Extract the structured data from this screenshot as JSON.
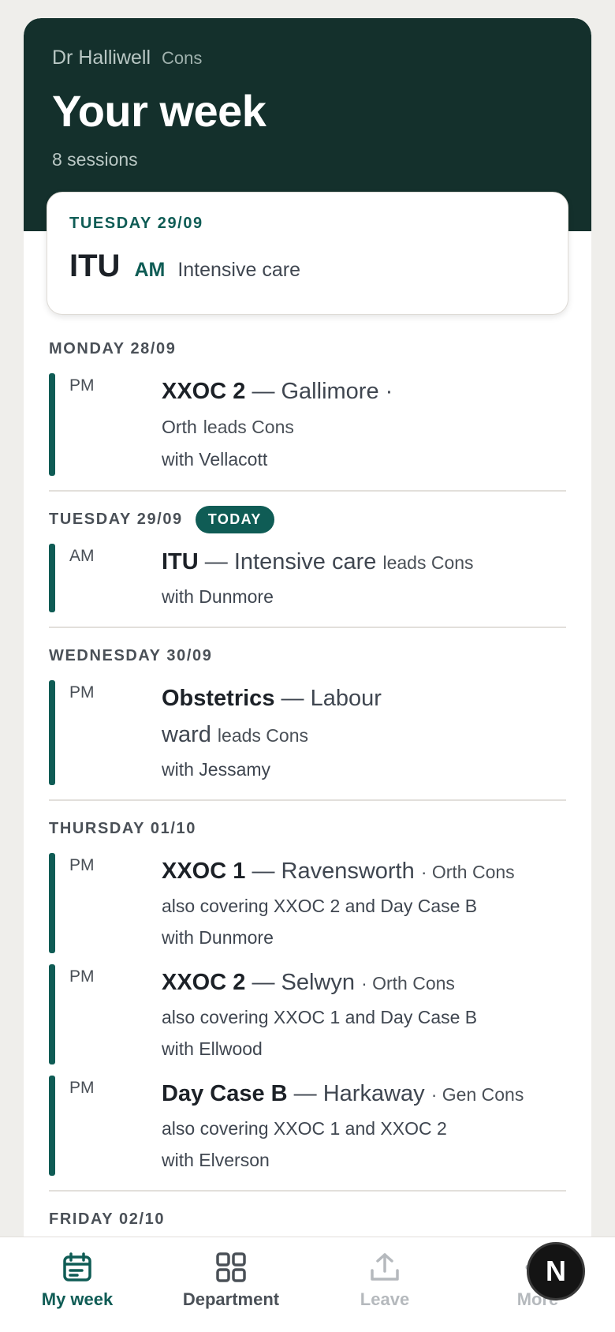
{
  "header": {
    "doctor_name": "Dr Halliwell",
    "doctor_grade": "Cons",
    "title": "Your week",
    "session_count": "8 sessions"
  },
  "today_card": {
    "date": "TUESDAY 29/09",
    "theatre": "ITU",
    "period": "AM",
    "description": "Intensive care"
  },
  "days": [
    {
      "label": "MONDAY 28/09",
      "badge": "",
      "sessions": [
        {
          "period": "PM",
          "theatre": "XXOC 2",
          "sep": "—",
          "surgeon": "Gallimore ·",
          "l2": "Orth",
          "l2_small": "leads Cons",
          "covering": "",
          "with": "with Vellacott"
        }
      ]
    },
    {
      "label": "TUESDAY 29/09",
      "badge": "TODAY",
      "sessions": [
        {
          "period": "AM",
          "theatre": "ITU",
          "sep": "—",
          "surgeon": "Intensive care",
          "small": "leads Cons",
          "with": "with Dunmore"
        }
      ]
    },
    {
      "label": "WEDNESDAY 30/09",
      "badge": "",
      "sessions": [
        {
          "period": "PM",
          "theatre": "Obstetrics",
          "sep": "—",
          "surgeon": "Labour",
          "l2": "ward",
          "l2_small": "leads Cons",
          "with": "with Jessamy"
        }
      ]
    },
    {
      "label": "THURSDAY 01/10",
      "badge": "",
      "sessions": [
        {
          "period": "PM",
          "theatre": "XXOC 1",
          "sep": "—",
          "surgeon": "Ravensworth",
          "small": "· Orth Cons",
          "covering": "also covering XXOC 2 and Day Case B",
          "with": "with Dunmore"
        },
        {
          "period": "PM",
          "theatre": "XXOC 2",
          "sep": "—",
          "surgeon": "Selwyn",
          "small": "· Orth Cons",
          "covering": "also covering XXOC 1 and Day Case B",
          "with": "with Ellwood"
        },
        {
          "period": "PM",
          "theatre": "Day Case B",
          "sep": "—",
          "surgeon": "Harkaway",
          "small": "· Gen Cons",
          "covering": "also covering XXOC 1 and XXOC 2",
          "with": "with Elverson"
        }
      ]
    },
    {
      "label": "FRIDAY 02/10",
      "badge": "",
      "sessions": []
    }
  ],
  "tabs": [
    {
      "label": "My week",
      "icon": "calendar-icon",
      "state": "active"
    },
    {
      "label": "Department",
      "icon": "grid-icon",
      "state": "normal"
    },
    {
      "label": "Leave",
      "icon": "upload-icon",
      "state": "disabled"
    },
    {
      "label": "More",
      "icon": "more-icon",
      "state": "disabled"
    }
  ],
  "fab": {
    "label": "N"
  },
  "colors": {
    "accent": "#0f5c55",
    "hero": "#14302c"
  }
}
